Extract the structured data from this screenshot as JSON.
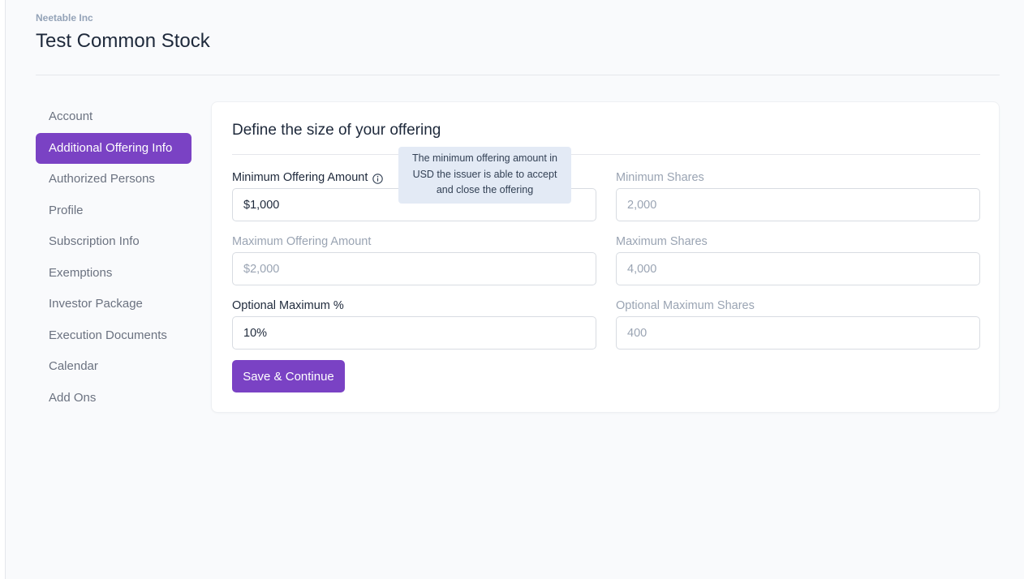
{
  "header": {
    "company": "Neetable Inc",
    "title": "Test Common Stock"
  },
  "sidebar": {
    "items": [
      {
        "label": "Account",
        "active": false
      },
      {
        "label": "Additional Offering Info",
        "active": true
      },
      {
        "label": "Authorized Persons",
        "active": false
      },
      {
        "label": "Profile",
        "active": false
      },
      {
        "label": "Subscription Info",
        "active": false
      },
      {
        "label": "Exemptions",
        "active": false
      },
      {
        "label": "Investor Package",
        "active": false
      },
      {
        "label": "Execution Documents",
        "active": false
      },
      {
        "label": "Calendar",
        "active": false
      },
      {
        "label": "Add Ons",
        "active": false
      }
    ]
  },
  "form": {
    "title": "Define the size of your offering",
    "fields": {
      "min_offering": {
        "label": "Minimum Offering Amount",
        "value": "$1,000",
        "disabled": false
      },
      "min_shares": {
        "label": "Minimum Shares",
        "value": "2,000",
        "disabled": true
      },
      "max_offering": {
        "label": "Maximum Offering Amount",
        "value": "$2,000",
        "disabled": true
      },
      "max_shares": {
        "label": "Maximum Shares",
        "value": "4,000",
        "disabled": true
      },
      "opt_max_pct": {
        "label": "Optional Maximum %",
        "value": "10%",
        "disabled": false
      },
      "opt_max_shares": {
        "label": "Optional Maximum Shares",
        "value": "400",
        "disabled": true
      }
    },
    "save_label": "Save & Continue",
    "tooltip": "The minimum offering amount in USD the issuer is able to accept and close the offering"
  },
  "colors": {
    "accent": "#7a42c4",
    "tooltip_bg": "#e3eaf5"
  }
}
